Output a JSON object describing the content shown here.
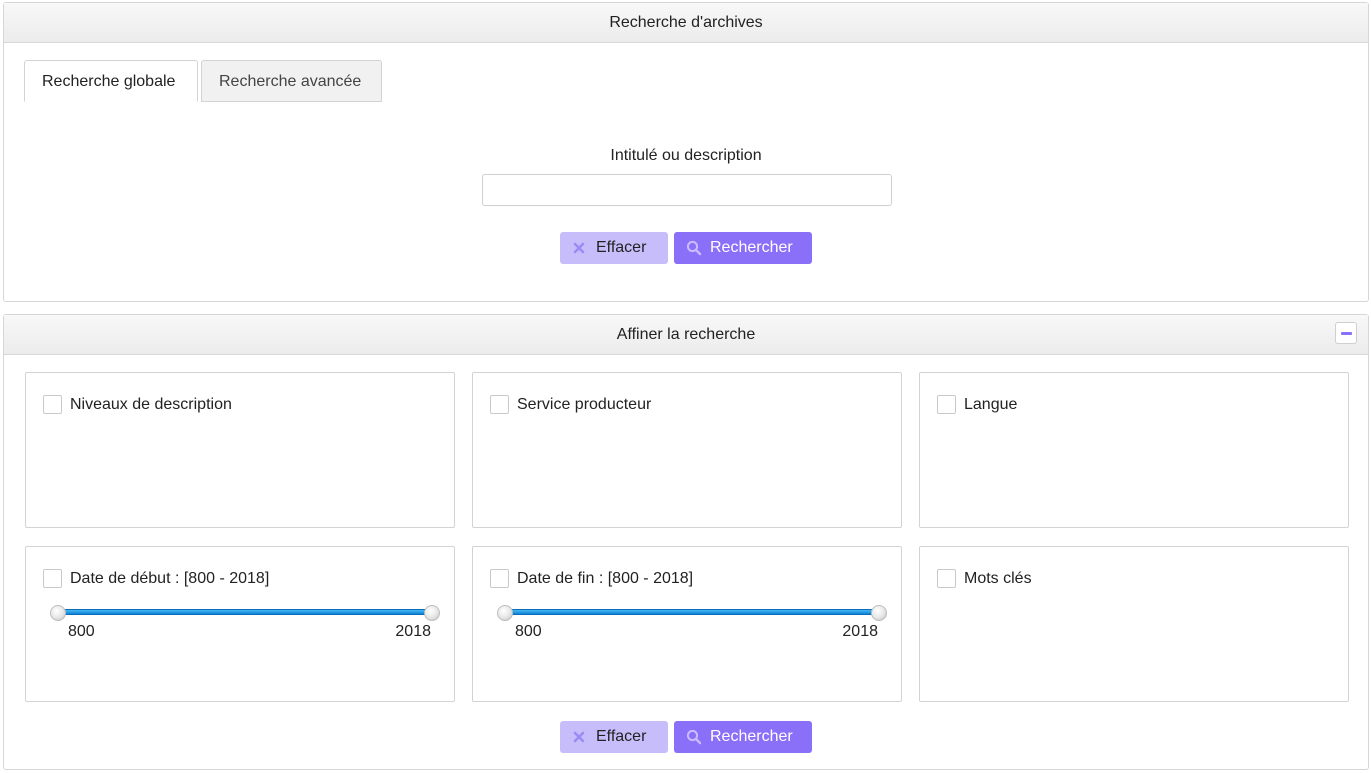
{
  "search_panel": {
    "title": "Recherche d'archives",
    "tabs": [
      {
        "label": "Recherche globale",
        "active": true
      },
      {
        "label": "Recherche avancée",
        "active": false
      }
    ],
    "field_label": "Intitulé ou description",
    "field_value": "",
    "field_placeholder": "",
    "clear_label": "Effacer",
    "search_label": "Rechercher"
  },
  "refine_panel": {
    "title": "Affiner la recherche",
    "collapse_icon": "minus-icon",
    "facets": [
      {
        "label": "Niveaux de description",
        "checked": false
      },
      {
        "label": "Service producteur",
        "checked": false
      },
      {
        "label": "Langue",
        "checked": false
      },
      {
        "label": "Date de début : [800 - 2018]",
        "checked": false,
        "range": {
          "min_label": "800",
          "max_label": "2018",
          "min": 800,
          "max": 2018
        }
      },
      {
        "label": "Date de fin : [800 - 2018]",
        "checked": false,
        "range": {
          "min_label": "800",
          "max_label": "2018",
          "min": 800,
          "max": 2018
        }
      },
      {
        "label": "Mots clés",
        "checked": false
      }
    ],
    "clear_label": "Effacer",
    "search_label": "Rechercher"
  },
  "colors": {
    "clear_button": "#c7bdfb",
    "search_button": "#8a6ff8",
    "slider_track": "#1a91e0"
  },
  "icons": {
    "clear": "close-icon",
    "search": "search-icon"
  }
}
